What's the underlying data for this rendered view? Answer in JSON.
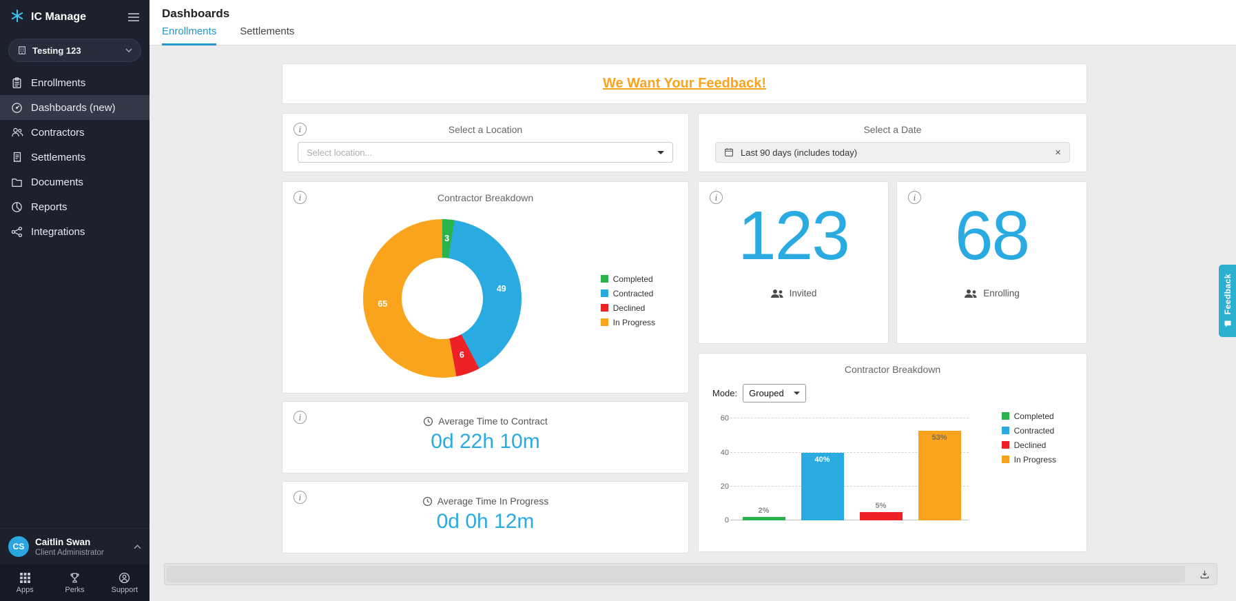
{
  "sidebar": {
    "brand": "IC Manage",
    "org": {
      "name": "Testing 123"
    },
    "nav": [
      {
        "label": "Enrollments",
        "icon": "enrollments-icon",
        "active": false
      },
      {
        "label": "Dashboards (new)",
        "icon": "dashboards-icon",
        "active": true
      },
      {
        "label": "Contractors",
        "icon": "contractors-icon",
        "active": false
      },
      {
        "label": "Settlements",
        "icon": "settlements-icon",
        "active": false
      },
      {
        "label": "Documents",
        "icon": "documents-icon",
        "active": false
      },
      {
        "label": "Reports",
        "icon": "reports-icon",
        "active": false
      },
      {
        "label": "Integrations",
        "icon": "integrations-icon",
        "active": false
      }
    ],
    "user": {
      "initials": "CS",
      "name": "Caitlin Swan",
      "role": "Client Administrator"
    },
    "footer": [
      {
        "label": "Apps",
        "icon": "apps-icon"
      },
      {
        "label": "Perks",
        "icon": "perks-icon"
      },
      {
        "label": "Support",
        "icon": "support-icon"
      }
    ]
  },
  "header": {
    "title": "Dashboards",
    "tabs": [
      {
        "label": "Enrollments",
        "active": true
      },
      {
        "label": "Settlements",
        "active": false
      }
    ]
  },
  "banner": {
    "text": "We Want Your Feedback!"
  },
  "filters": {
    "location": {
      "title": "Select a Location",
      "placeholder": "Select location..."
    },
    "date": {
      "title": "Select a Date",
      "value": "Last 90 days (includes today)"
    }
  },
  "stats": {
    "invited": {
      "value": "123",
      "label": "Invited"
    },
    "enrolling": {
      "value": "68",
      "label": "Enrolling"
    }
  },
  "avg_time_contract": {
    "title": "Average Time to Contract",
    "value": "0d 22h 10m"
  },
  "avg_time_progress": {
    "title": "Average Time In Progress",
    "value": "0d 0h 12m"
  },
  "bar_controls": {
    "mode_label": "Mode:",
    "mode_value": "Grouped"
  },
  "feedback_tab": {
    "label": "Feedback"
  },
  "colors": {
    "accent_blue": "#29abe2",
    "green": "#2bb34b",
    "red": "#ec2227",
    "orange": "#f9a41c",
    "sidebar_bg": "#1c212d"
  },
  "chart_data": [
    {
      "type": "pie",
      "donut": true,
      "title": "Contractor Breakdown",
      "labels": [
        "Completed",
        "Contracted",
        "Declined",
        "In Progress"
      ],
      "values": [
        3,
        49,
        6,
        65
      ],
      "colors": [
        "#2bb34b",
        "#29abe2",
        "#ec2227",
        "#f9a41c"
      ],
      "legend_position": "right"
    },
    {
      "type": "bar",
      "title": "Contractor Breakdown",
      "mode": "Grouped",
      "categories": [
        "Completed",
        "Contracted",
        "Declined",
        "In Progress"
      ],
      "values": [
        2,
        40,
        5,
        53
      ],
      "value_labels": [
        "2%",
        "40%",
        "5%",
        "53%"
      ],
      "value_label_colors": [
        "#888888",
        "#ffffff",
        "#888888",
        "#6d6d6d"
      ],
      "colors": [
        "#2bb34b",
        "#29abe2",
        "#ec2227",
        "#f9a41c"
      ],
      "ylim": [
        0,
        65
      ],
      "yticks": [
        0,
        20,
        40,
        60
      ],
      "grid": true,
      "legend_position": "right"
    }
  ]
}
